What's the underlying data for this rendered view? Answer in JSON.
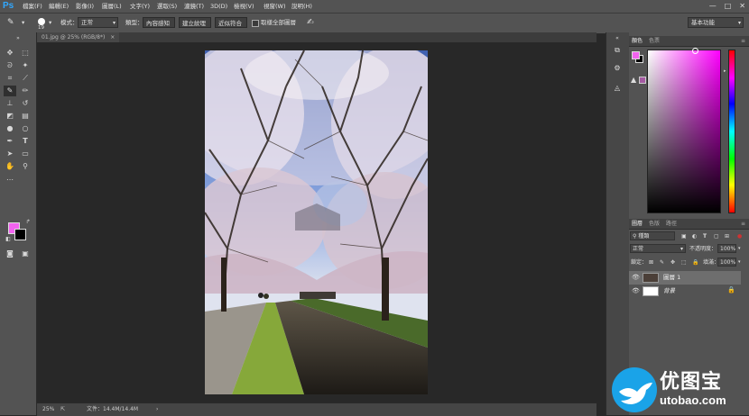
{
  "app": {
    "logo": "Ps"
  },
  "menu": [
    "檔案(F)",
    "編輯(E)",
    "影像(I)",
    "圖層(L)",
    "文字(Y)",
    "選取(S)",
    "濾鏡(T)",
    "3D(D)",
    "檢視(V)",
    "視窗(W)",
    "說明(H)"
  ],
  "window_controls": [
    "—",
    "□",
    "✕"
  ],
  "options_bar": {
    "brush_size": "19",
    "mode_label": "模式：",
    "mode_value": "正常",
    "type_label": "類型：",
    "btn_content_aware": "內容感知",
    "btn_create_texture": "建立紋理",
    "btn_proximity_match": "近似符合",
    "sample_all_layers": "取樣全部圖層",
    "workspace": "基本功能"
  },
  "document": {
    "tab_title": "01.jpg @ 25% (RGB/8*)",
    "tab_close": "×",
    "zoom": "25%",
    "file_info": "文件：14.4M/14.4M",
    "nav_arrow": "›"
  },
  "color_panel": {
    "tabs": [
      "顏色",
      "色票"
    ],
    "foreground": "#f263ef",
    "background": "#000000",
    "gamut_warning_icon": "▲"
  },
  "layers_panel": {
    "tabs": [
      "圖層",
      "色版",
      "路徑"
    ],
    "filter_label": "種類",
    "blend_mode": "正常",
    "opacity_label": "不透明度：",
    "opacity_value": "100%",
    "lock_label": "鎖定：",
    "fill_label": "填滿：",
    "fill_value": "100%",
    "layers": [
      {
        "name": "圖層 1",
        "selected": true,
        "locked": false
      },
      {
        "name": "背景",
        "selected": false,
        "locked": true
      }
    ]
  },
  "watermark": {
    "title": "优图宝",
    "domain": "utobao.com"
  },
  "colors": {
    "chrome": "#535353",
    "canvas_bg": "#282828",
    "accent": "#31a8ff",
    "watermark_blue": "#1aa3e8"
  }
}
